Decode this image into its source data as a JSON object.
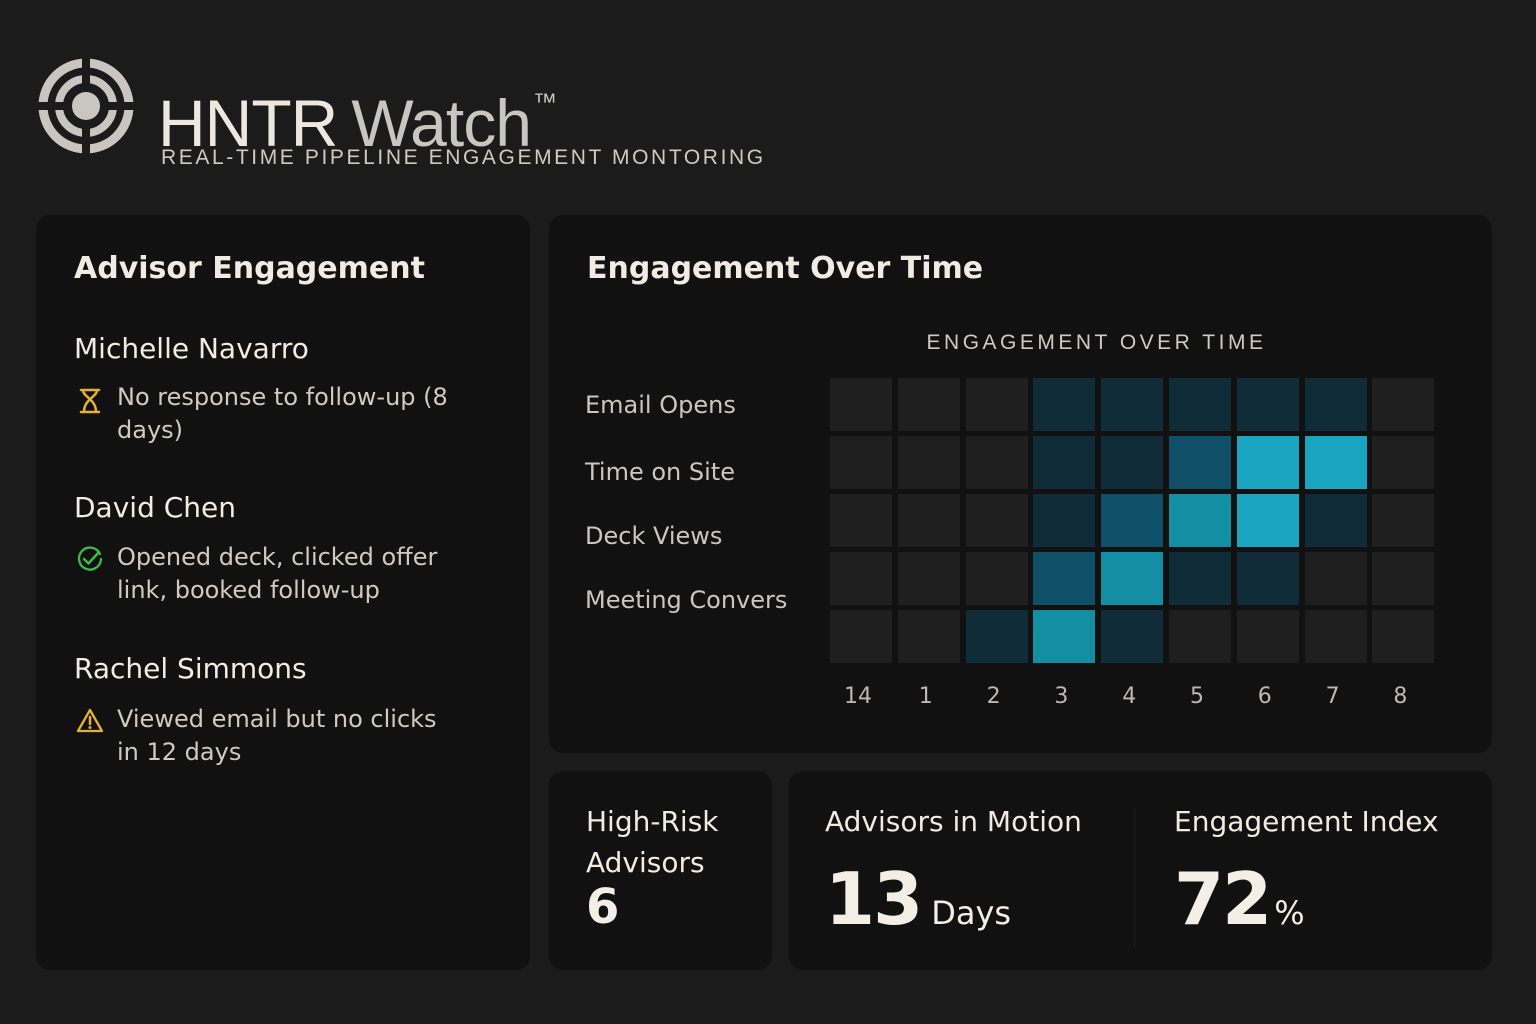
{
  "header": {
    "brand_hntr": "HNTR",
    "brand_watch": "Watch",
    "trademark": "™",
    "tagline": "REAL-TIME PIPELINE ENGAGEMENT MONTORING",
    "logo_icon": "target-icon"
  },
  "advisor_panel": {
    "title": "Advisor Engagement",
    "advisors": [
      {
        "name": "Michelle Navarro",
        "status": "No response to follow-up (8 days)",
        "icon": "hourglass-icon",
        "icon_color": "#e6b12e"
      },
      {
        "name": "David Chen",
        "status": "Opened deck, clicked offer link, booked follow-up",
        "icon": "check-circle-icon",
        "icon_color": "#3fb84c"
      },
      {
        "name": "Rachel Simmons",
        "status": "Viewed email but no clicks in 12 days",
        "icon": "warning-icon",
        "icon_color": "#e6b12e"
      }
    ]
  },
  "engagement_panel": {
    "title": "Engagement Over Time"
  },
  "chart_data": {
    "type": "heatmap",
    "title": "ENGAGEMENT OVER TIME",
    "row_labels": [
      "Email Opens",
      "Time on Site",
      "Deck Views",
      "Meeting Convers",
      ""
    ],
    "x_ticks": [
      "14",
      "1",
      "2",
      "3",
      "4",
      "5",
      "6",
      "7",
      "8"
    ],
    "intensity_scale": "0 = none, 4 = highest",
    "values": [
      [
        0,
        0,
        0,
        1,
        1,
        1,
        1,
        1,
        0
      ],
      [
        0,
        0,
        0,
        1,
        1,
        2,
        4,
        4,
        0
      ],
      [
        0,
        0,
        0,
        1,
        2,
        3,
        4,
        1,
        0
      ],
      [
        0,
        0,
        0,
        2,
        3,
        1,
        1,
        0,
        0
      ],
      [
        0,
        0,
        1,
        3,
        1,
        0,
        0,
        0,
        0
      ]
    ],
    "colors": [
      "#1f1f1f",
      "#0f2c38",
      "#0f5068",
      "#138ea3",
      "#1aa6c0"
    ]
  },
  "stats": {
    "high_risk_label": "High-Risk Advisors",
    "high_risk_value": "6",
    "in_motion_label": "Advisors in Motion",
    "in_motion_value": "13",
    "in_motion_unit": "Days",
    "index_label": "Engagement Index",
    "index_value": "72",
    "index_unit": "%"
  }
}
